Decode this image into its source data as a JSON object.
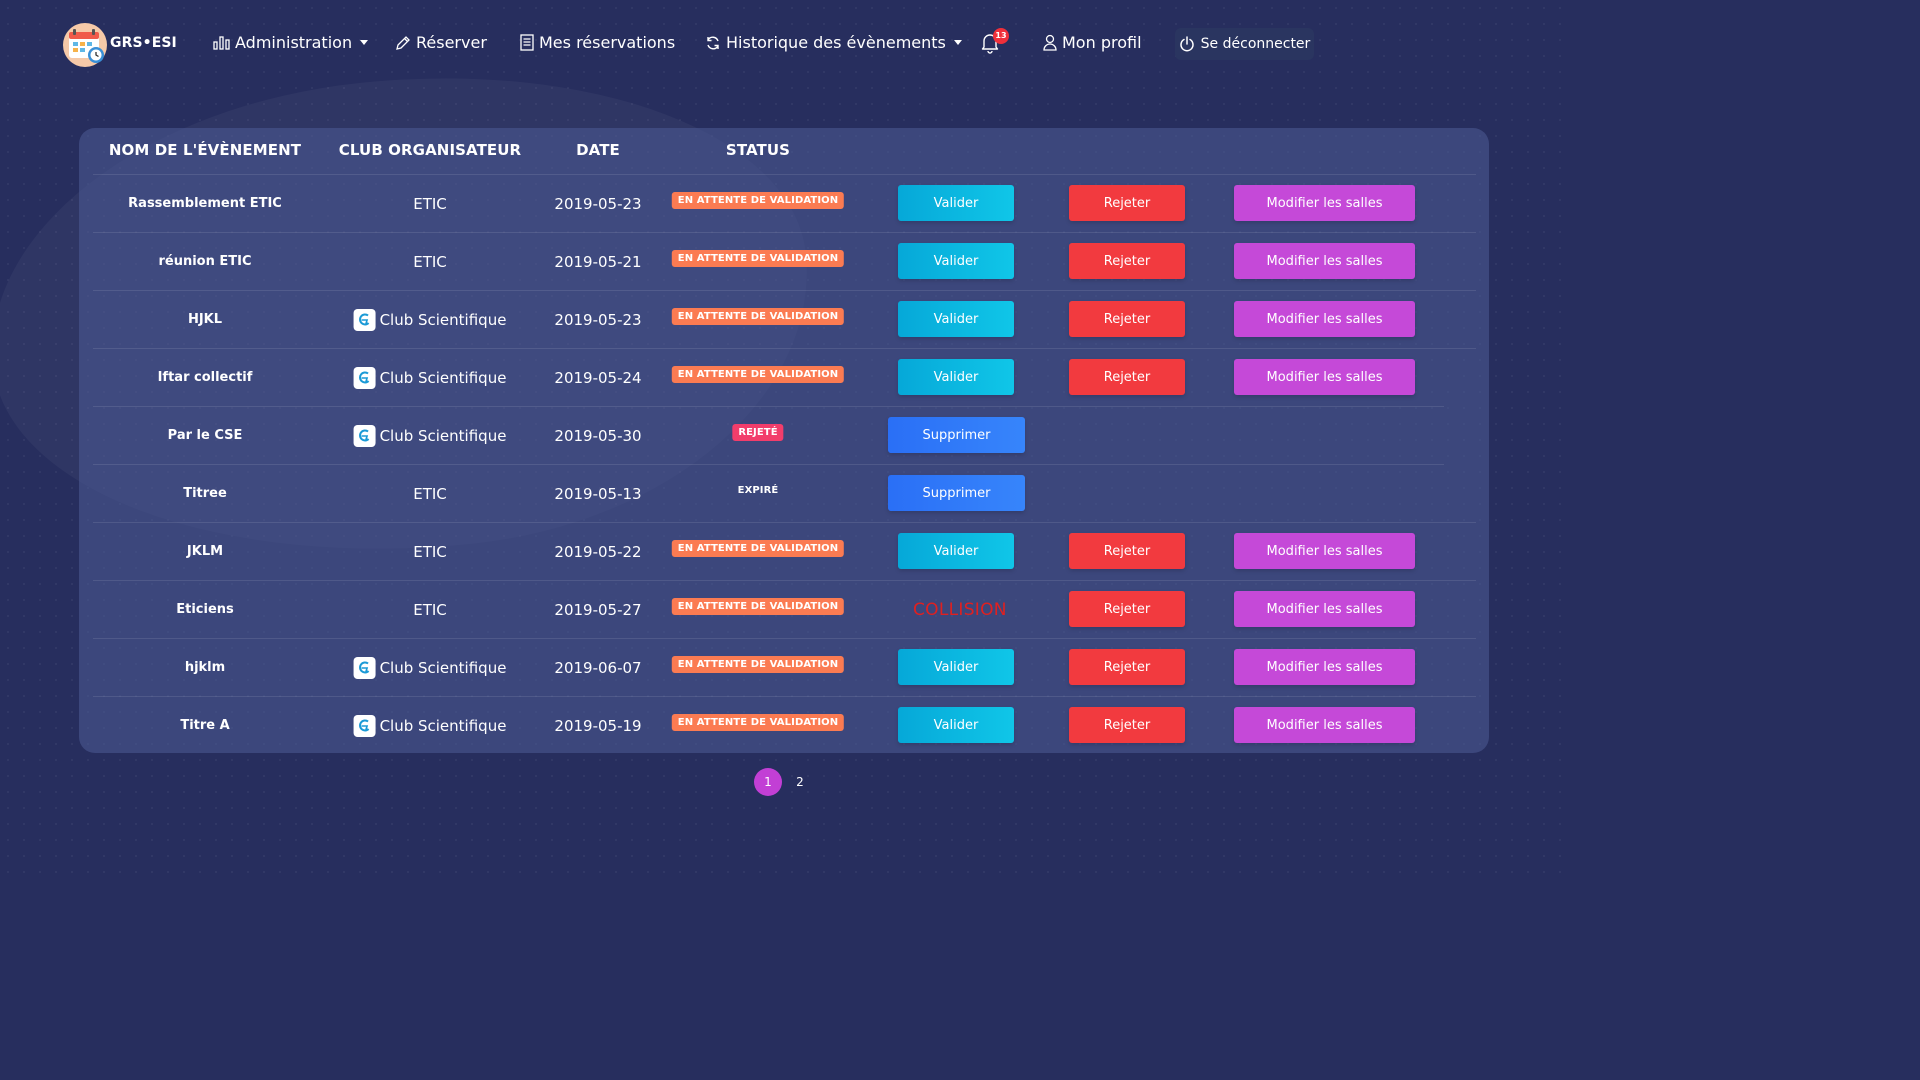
{
  "brand": {
    "name": "GRS•ESI"
  },
  "nav": {
    "administration": "Administration",
    "reserve": "Réserver",
    "my_reservations": "Mes réservations",
    "history": "Historique des évènements",
    "notifications_count": "13",
    "profile": "Mon profil",
    "logout": "Se déconnecter"
  },
  "table": {
    "headers": [
      "NOM DE L'ÉVÈNEMENT",
      "CLUB ORGANISATEUR",
      "DATE",
      "STATUS"
    ],
    "rows": [
      {
        "name": "Rassemblement ETIC",
        "club": "ETIC",
        "club_icon": false,
        "date": "2019-05-23",
        "status": "EN ATTENTE DE VALIDATION",
        "status_type": "pending",
        "actions": "full"
      },
      {
        "name": "réunion ETIC",
        "club": "ETIC",
        "club_icon": false,
        "date": "2019-05-21",
        "status": "EN ATTENTE DE VALIDATION",
        "status_type": "pending",
        "actions": "full"
      },
      {
        "name": "HJKL",
        "club": "Club Scientifique",
        "club_icon": true,
        "date": "2019-05-23",
        "status": "EN ATTENTE DE VALIDATION",
        "status_type": "pending",
        "actions": "full"
      },
      {
        "name": "Iftar collectif",
        "club": "Club Scientifique",
        "club_icon": true,
        "date": "2019-05-24",
        "status": "EN ATTENTE DE VALIDATION",
        "status_type": "pending",
        "actions": "full"
      },
      {
        "name": "Par le CSE",
        "club": "Club Scientifique",
        "club_icon": true,
        "date": "2019-05-30",
        "status": "REJETÉ",
        "status_type": "rejected",
        "actions": "delete"
      },
      {
        "name": "Titree",
        "club": "ETIC",
        "club_icon": false,
        "date": "2019-05-13",
        "status": "EXPIRÉ",
        "status_type": "expired",
        "actions": "delete"
      },
      {
        "name": "JKLM",
        "club": "ETIC",
        "club_icon": false,
        "date": "2019-05-22",
        "status": "EN ATTENTE DE VALIDATION",
        "status_type": "pending",
        "actions": "full"
      },
      {
        "name": "Eticiens",
        "club": "ETIC",
        "club_icon": false,
        "date": "2019-05-27",
        "status": "EN ATTENTE DE VALIDATION",
        "status_type": "pending",
        "actions": "collision"
      },
      {
        "name": "hjklm",
        "club": "Club Scientifique",
        "club_icon": true,
        "date": "2019-06-07",
        "status": "EN ATTENTE DE VALIDATION",
        "status_type": "pending",
        "actions": "full"
      },
      {
        "name": "Titre A",
        "club": "Club Scientifique",
        "club_icon": true,
        "date": "2019-05-19",
        "status": "EN ATTENTE DE VALIDATION",
        "status_type": "pending",
        "actions": "full"
      }
    ]
  },
  "actions": {
    "validate": "Valider",
    "reject": "Rejeter",
    "modify": "Modifier les salles",
    "delete": "Supprimer",
    "collision": "COLLISION"
  },
  "pagination": {
    "pages": [
      "1",
      "2"
    ],
    "current": "1"
  },
  "colors": {
    "background": "#272e5e",
    "validate": "#10c6e8",
    "reject": "#f23a3f",
    "modify": "#c549d8",
    "delete": "#2a6ff6",
    "pending_badge": "#fb7b52",
    "rejected_badge": "#f23d6b",
    "active_page": "#c23fd5"
  },
  "icons": {
    "logo": "calendar-clock-icon",
    "administration": "bar-chart-icon",
    "reserve": "pencil-icon",
    "my_reservations": "document-list-icon",
    "history": "refresh-icon",
    "notifications": "bell-icon",
    "profile": "user-icon",
    "logout": "power-icon",
    "club_scientifique": "club-logo-icon"
  }
}
